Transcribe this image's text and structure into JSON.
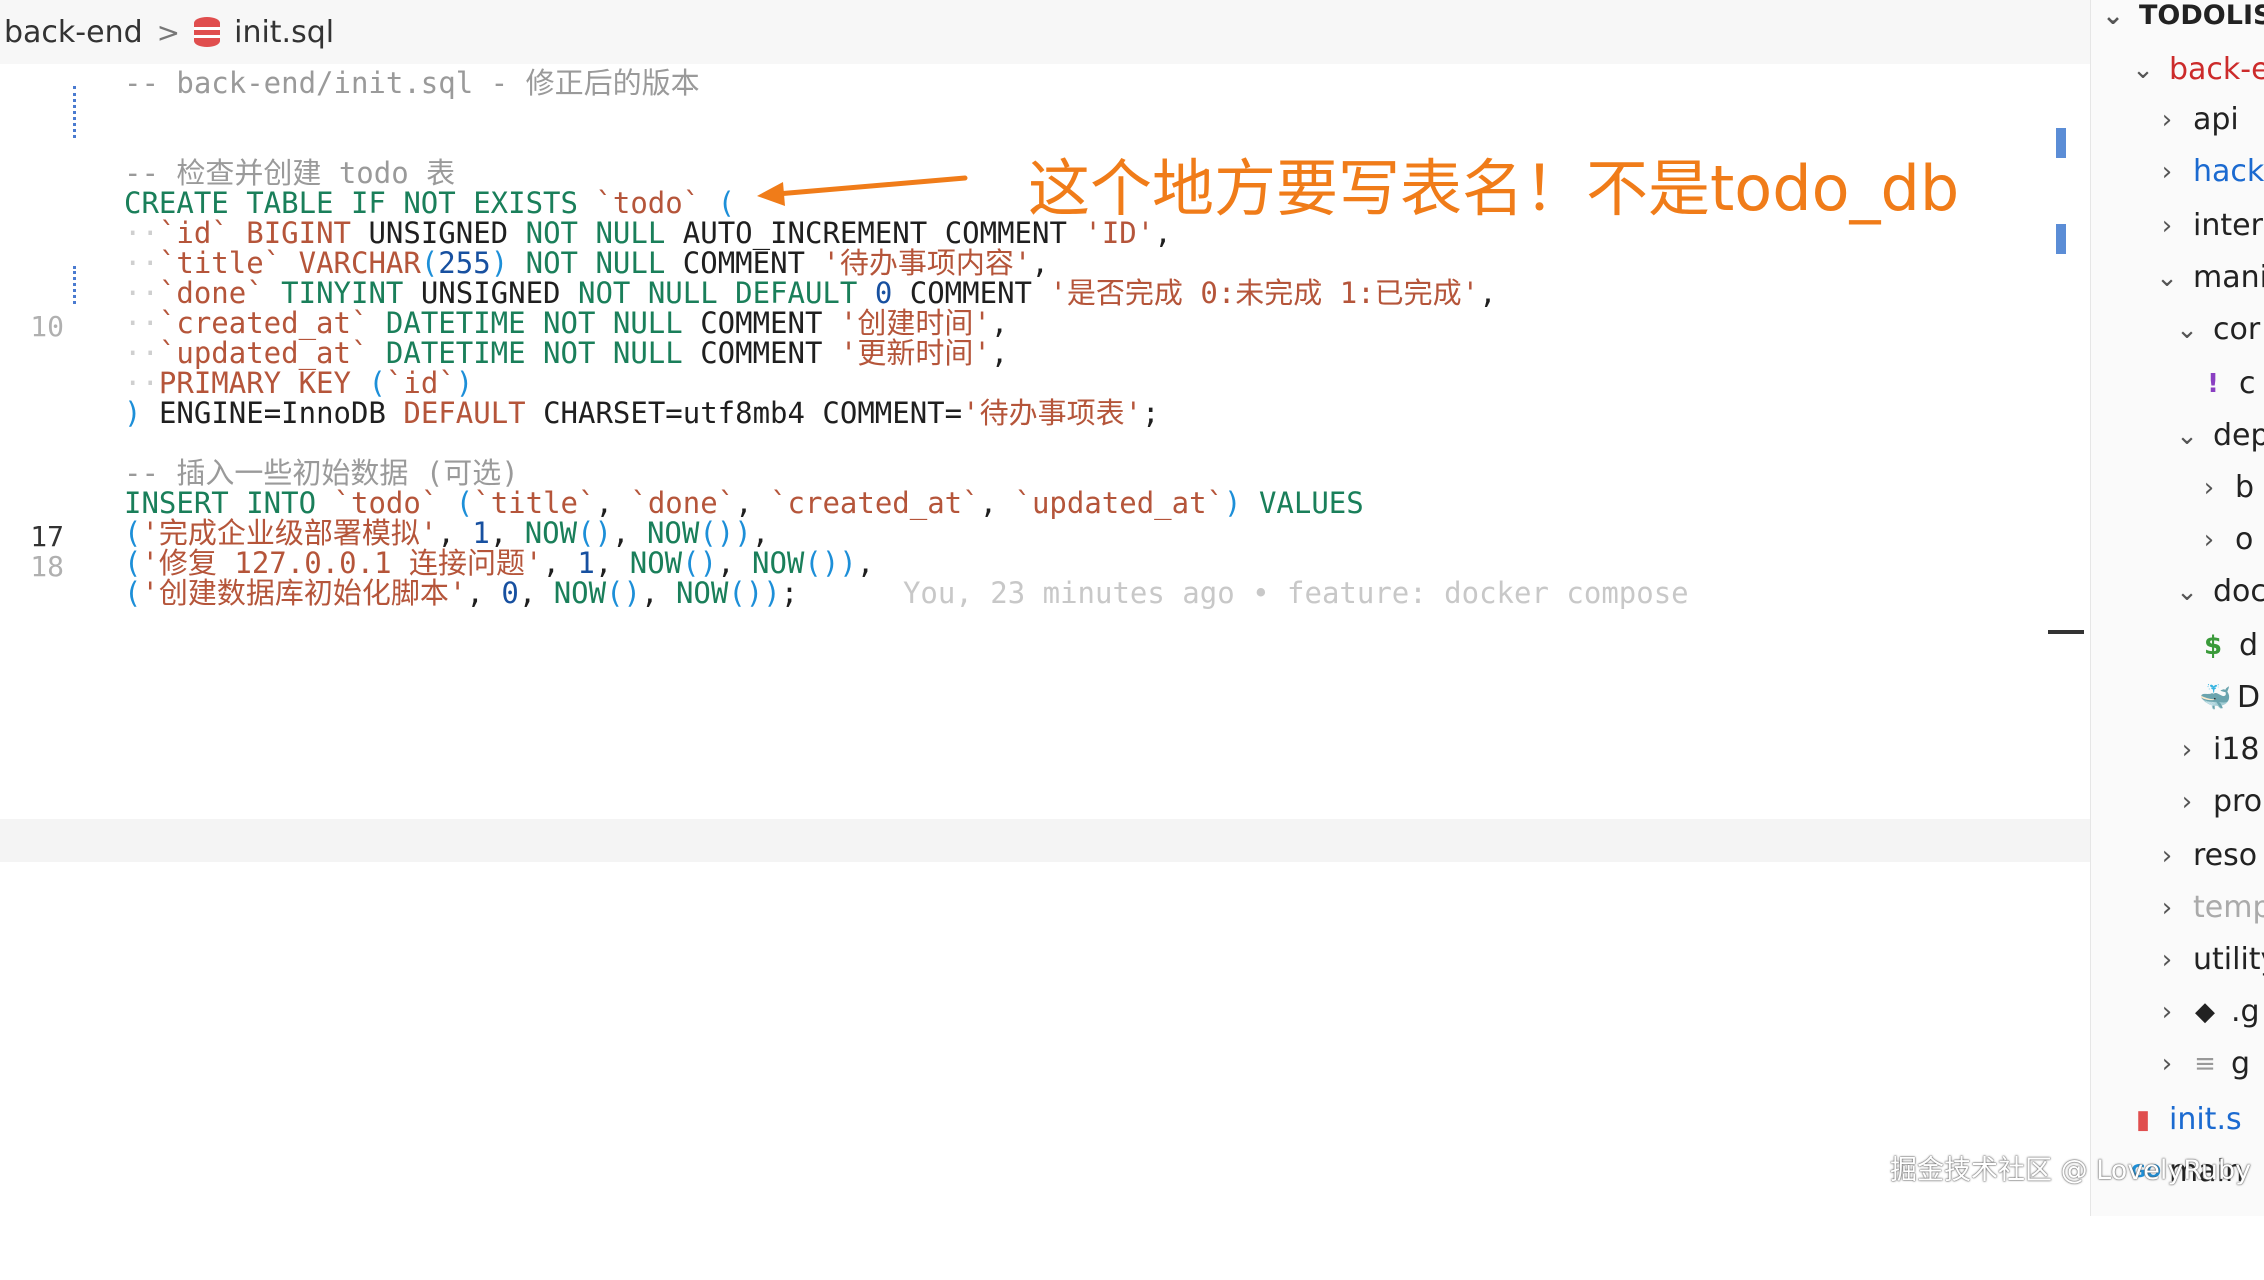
{
  "breadcrumb": {
    "folder": "back-end",
    "file": "init.sql",
    "separator": ">"
  },
  "annotation": {
    "text": "这个地方要写表名！不是todo_db",
    "color": "#f07c19"
  },
  "gutter": {
    "line10": "10",
    "line17": "17",
    "line18": "18"
  },
  "code": {
    "l1": "-- back-end/init.sql - 修正后的版本",
    "l3": "-- 检查并创建 todo 表",
    "l4a": "CREATE TABLE IF NOT EXISTS",
    "l4b": "`todo`",
    "l4c": "(",
    "l5a": "`id`",
    "l5b": "BIGINT",
    "l5c": "UNSIGNED",
    "l5d": "NOT NULL",
    "l5e": "AUTO_INCREMENT",
    "l5f": "COMMENT",
    "l5g": "'ID'",
    "l6a": "`title`",
    "l6b": "VARCHAR",
    "l6c": "255",
    "l6d": "NOT NULL",
    "l6e": "COMMENT",
    "l6f": "'待办事项内容'",
    "l7a": "`done`",
    "l7b": "TINYINT",
    "l7c": "UNSIGNED",
    "l7d": "NOT NULL DEFAULT",
    "l7e": "0",
    "l7f": "COMMENT",
    "l7g": "'是否完成 0:未完成 1:已完成'",
    "l8a": "`created_at`",
    "l8b": "DATETIME NOT NULL",
    "l8c": "COMMENT",
    "l8d": "'创建时间'",
    "l9a": "`updated_at`",
    "l9b": "DATETIME NOT NULL",
    "l9c": "COMMENT",
    "l9d": "'更新时间'",
    "l10a": "PRIMARY KEY",
    "l10b": "`id`",
    "l11a": "ENGINE=InnoDB",
    "l11b": "DEFAULT",
    "l11c": "CHARSET=utf8mb4 COMMENT=",
    "l11d": "'待办事项表'",
    "l13": "-- 插入一些初始数据 (可选)",
    "l14a": "INSERT INTO",
    "l14b": "`todo`",
    "l14c": "`title`",
    "l14d": "`done`",
    "l14e": "`created_at`",
    "l14f": "`updated_at`",
    "l14g": "VALUES",
    "l15a": "'完成企业级部署模拟'",
    "l15b": "1",
    "l15c": "NOW",
    "l15d": "NOW",
    "l16a": "'修复 127.0.0.1 连接问题'",
    "l16b": "1",
    "l16c": "NOW",
    "l16d": "NOW",
    "l17a": "'创建数据库初始化脚本'",
    "l17b": "0",
    "l17c": "NOW",
    "l17d": "NOW",
    "blame": "You, 23 minutes ago • feature: docker compose"
  },
  "explorer": {
    "root": "TODOLIST",
    "items": [
      "back-e",
      "api",
      "hack",
      "inter",
      "mani",
      "cor",
      "c",
      "dep",
      "b",
      "o",
      "doc",
      "d",
      "D",
      "i18",
      "pro",
      "reso",
      "temp",
      "utility",
      ".g",
      "g",
      "init.s",
      "main"
    ]
  },
  "watermark": "掘金技术社区 @ LovelyRuby",
  "colors": {
    "keyword": "#1a7f5a",
    "string": "#b5553a",
    "number": "#1750a0",
    "comment": "#9a9a9a",
    "annotation": "#f07c19",
    "explorer_folder_red": "#cc2b2b",
    "explorer_blue": "#1b6ad0"
  }
}
